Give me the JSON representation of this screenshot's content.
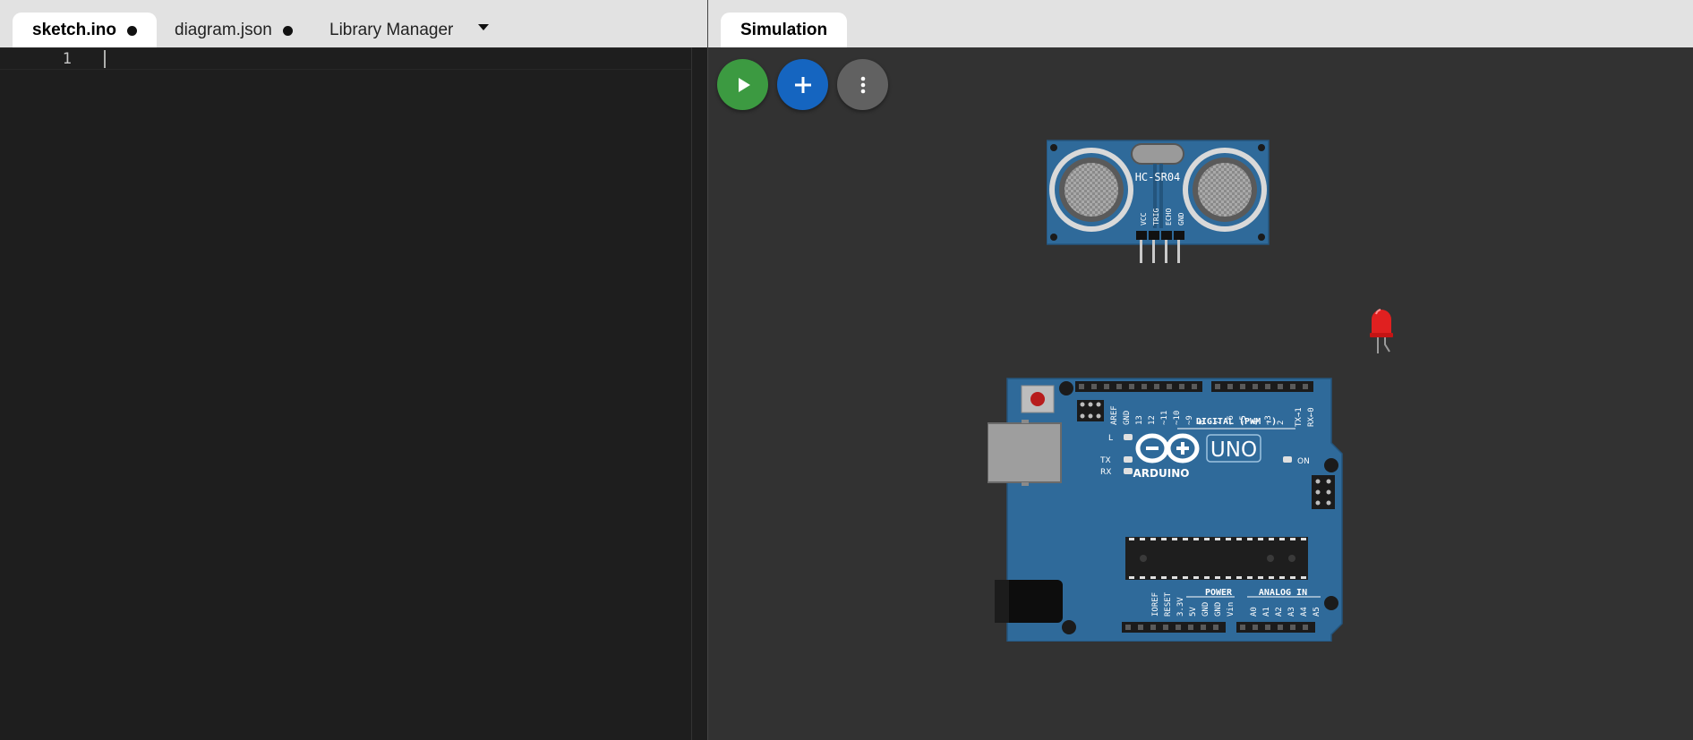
{
  "editor": {
    "tabs": [
      {
        "label": "sketch.ino",
        "modified": true,
        "active": true
      },
      {
        "label": "diagram.json",
        "modified": true,
        "active": false
      },
      {
        "label": "Library Manager",
        "modified": false,
        "active": false
      }
    ],
    "line_numbers": [
      "1"
    ]
  },
  "simulation": {
    "tab_label": "Simulation",
    "toolbar": {
      "play_icon": "play-icon",
      "add_icon": "plus-icon",
      "more_icon": "vertical-dots-icon"
    },
    "sensor": {
      "label": "HC-SR04",
      "pins": [
        "VCC",
        "TRIG",
        "ECHO",
        "GND"
      ]
    },
    "arduino": {
      "uno_label": "UNO",
      "brand_label": "ARDUINO",
      "digital_label": "DIGITAL (PWM ~)",
      "power_label": "POWER",
      "analog_label": "ANALOG IN",
      "on_label": "ON",
      "l_label": "L",
      "tx_label": "TX",
      "rx_label": "RX",
      "digital_pins": [
        "AREF",
        "GND",
        "13",
        "12",
        "~11",
        "~10",
        "~9",
        "8",
        "7",
        "~6",
        "~5",
        "4",
        "~3",
        "2",
        "TX→1",
        "RX←0"
      ],
      "power_pins": [
        "IOREF",
        "RESET",
        "3.3V",
        "5V",
        "GND",
        "GND",
        "Vin"
      ],
      "analog_pins": [
        "A0",
        "A1",
        "A2",
        "A3",
        "A4",
        "A5"
      ]
    }
  },
  "colors": {
    "board_blue": "#2f6a9a",
    "led_red": "#e02020",
    "play_green": "#3c9a41",
    "add_blue": "#1565c0",
    "more_gray": "#616161",
    "canvas_bg": "#323232",
    "editor_bg": "#1e1e1e"
  }
}
